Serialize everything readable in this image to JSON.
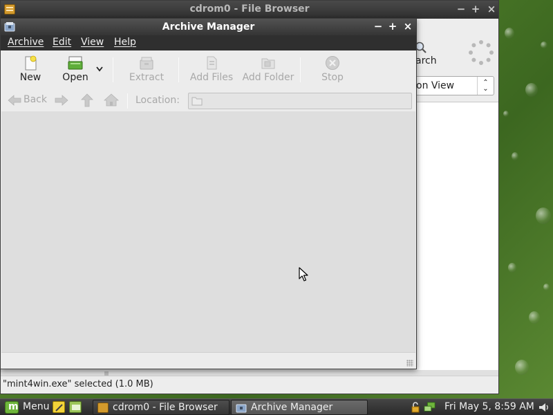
{
  "file_browser": {
    "title": "cdrom0 - File Browser",
    "search_label": "arch",
    "view_select": "on View",
    "status": "\"mint4win.exe\" selected (1.0 MB)",
    "controls": [
      "−",
      "+",
      "×"
    ]
  },
  "archive_manager": {
    "title": "Archive Manager",
    "controls": [
      "−",
      "+",
      "×"
    ],
    "menu": [
      "Archive",
      "Edit",
      "View",
      "Help"
    ],
    "toolbar": {
      "new": "New",
      "open": "Open",
      "extract": "Extract",
      "add_files": "Add Files",
      "add_folder": "Add Folder",
      "stop": "Stop"
    },
    "locationbar": {
      "back": "Back",
      "location_label": "Location:",
      "location_value": ""
    }
  },
  "taskbar": {
    "menu_label": "Menu",
    "tasks": [
      {
        "label": "cdrom0 - File Browser",
        "active": false
      },
      {
        "label": "Archive Manager",
        "active": true
      }
    ],
    "clock": "Fri May  5,  8:59 AM"
  },
  "colors": {
    "titlebar": "#3a3a3a",
    "menubar": "#2f2f2f",
    "window_bg": "#ececec",
    "content_bg": "#dedede",
    "desktop": "#4f7d2a",
    "disabled_text": "#a8a8a8"
  }
}
